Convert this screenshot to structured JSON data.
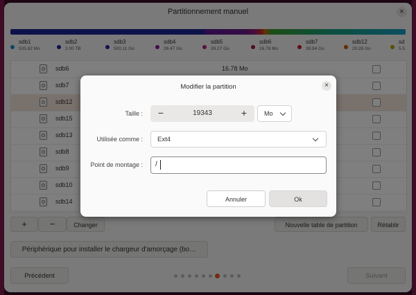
{
  "window": {
    "title": "Partitionnement manuel",
    "close_glyph": "×"
  },
  "legend": [
    {
      "name": "sdb1",
      "size": "535.82 Mo",
      "color": "#1a8cc8"
    },
    {
      "name": "sdb2",
      "size": "2.00 TB",
      "color": "#1d2594"
    },
    {
      "name": "sdb3",
      "size": "500.11 Go",
      "color": "#3a1a9a"
    },
    {
      "name": "sdb4",
      "size": "26.47 Go",
      "color": "#8a1a9a"
    },
    {
      "name": "sdb5",
      "size": "39.27 Go",
      "color": "#b01a8a"
    },
    {
      "name": "sdb6",
      "size": "16.78 Mo",
      "color": "#a01a4a"
    },
    {
      "name": "sdb7",
      "size": "39.94 Go",
      "color": "#c01a1a"
    },
    {
      "name": "sdb12",
      "size": "20.28 Go",
      "color": "#c05a0a"
    },
    {
      "name": "sd",
      "size": "5.5",
      "color": "#b89a0a"
    }
  ],
  "rows": [
    {
      "name": "sdb6",
      "size": "16.78 Mo"
    },
    {
      "name": "sdb7",
      "size": ""
    },
    {
      "name": "sdb12",
      "size": ""
    },
    {
      "name": "sdb15",
      "size": ""
    },
    {
      "name": "sdb13",
      "size": ""
    },
    {
      "name": "sdb8",
      "size": ""
    },
    {
      "name": "sdb9",
      "size": ""
    },
    {
      "name": "sdb10",
      "size": ""
    },
    {
      "name": "sdb14",
      "size": ""
    }
  ],
  "toolbar": {
    "add": "+",
    "remove": "−",
    "change": "Changer",
    "new_table": "Nouvelle table de partition",
    "restore": "Rétablir"
  },
  "bootloader_label": "Périphérique pour installer le chargeur d'amorçage (bo…",
  "nav": {
    "previous": "Précédent",
    "next": "Suivant"
  },
  "steps": {
    "count": 10,
    "active": 7
  },
  "dialog": {
    "title": "Modifier la partition",
    "close_glyph": "×",
    "size_label": "Taille :",
    "decrement": "−",
    "size_value": "19343",
    "increment": "+",
    "unit": "Mo",
    "use_as_label": "Utilisée comme :",
    "filesystem": "Ext4",
    "mount_label": "Point de montage :",
    "mount_value": "/",
    "cancel": "Annuler",
    "ok": "Ok"
  }
}
